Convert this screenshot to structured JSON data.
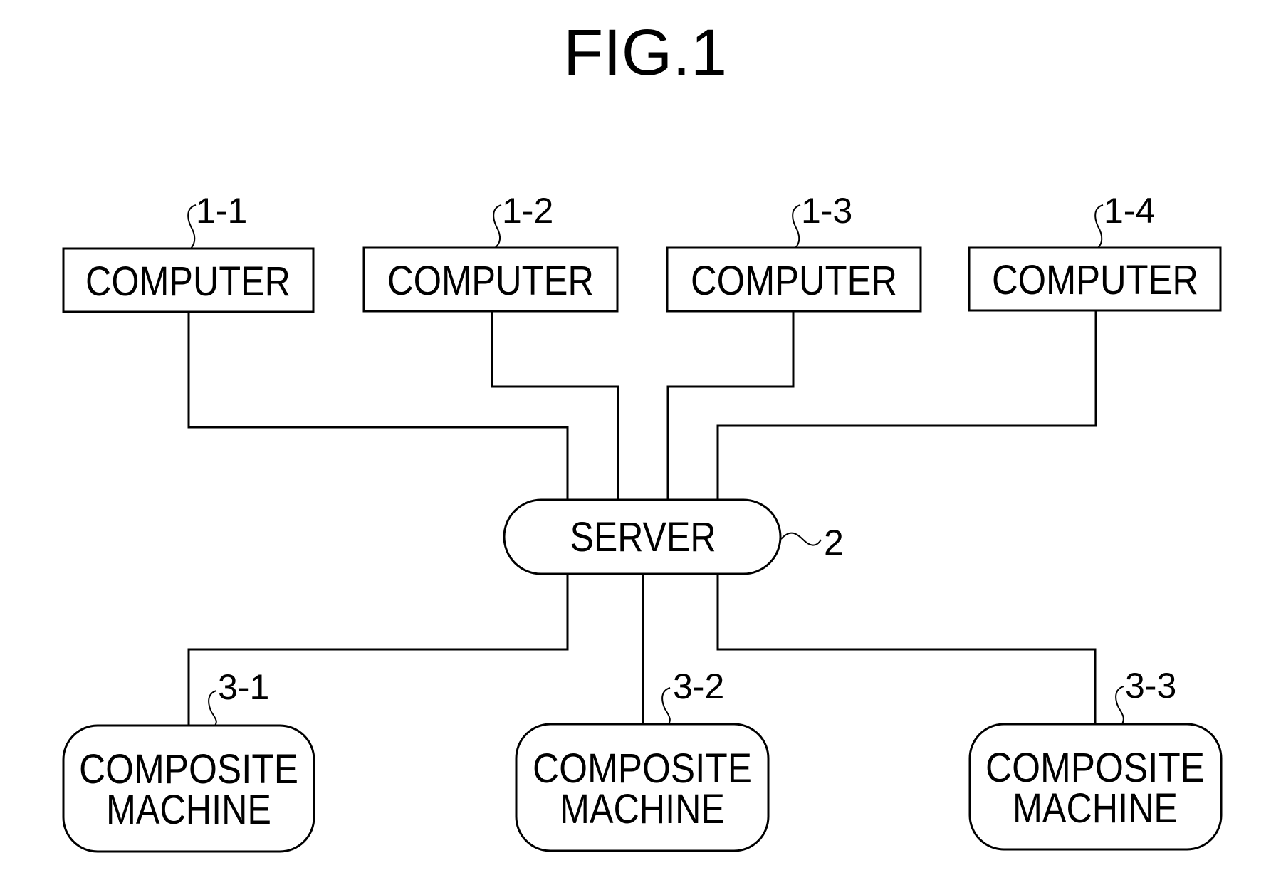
{
  "figure": {
    "title": "FIG.1"
  },
  "computers": [
    {
      "ref": "1-1",
      "label": "COMPUTER"
    },
    {
      "ref": "1-2",
      "label": "COMPUTER"
    },
    {
      "ref": "1-3",
      "label": "COMPUTER"
    },
    {
      "ref": "1-4",
      "label": "COMPUTER"
    }
  ],
  "server": {
    "ref": "2",
    "label": "SERVER"
  },
  "composite_machines": [
    {
      "ref": "3-1",
      "label_line1": "COMPOSITE",
      "label_line2": "MACHINE"
    },
    {
      "ref": "3-2",
      "label_line1": "COMPOSITE",
      "label_line2": "MACHINE"
    },
    {
      "ref": "3-3",
      "label_line1": "COMPOSITE",
      "label_line2": "MACHINE"
    }
  ],
  "connections": [
    {
      "from": "1-1",
      "to": "2"
    },
    {
      "from": "1-2",
      "to": "2"
    },
    {
      "from": "1-3",
      "to": "2"
    },
    {
      "from": "1-4",
      "to": "2"
    },
    {
      "from": "2",
      "to": "3-1"
    },
    {
      "from": "2",
      "to": "3-2"
    },
    {
      "from": "2",
      "to": "3-3"
    }
  ]
}
